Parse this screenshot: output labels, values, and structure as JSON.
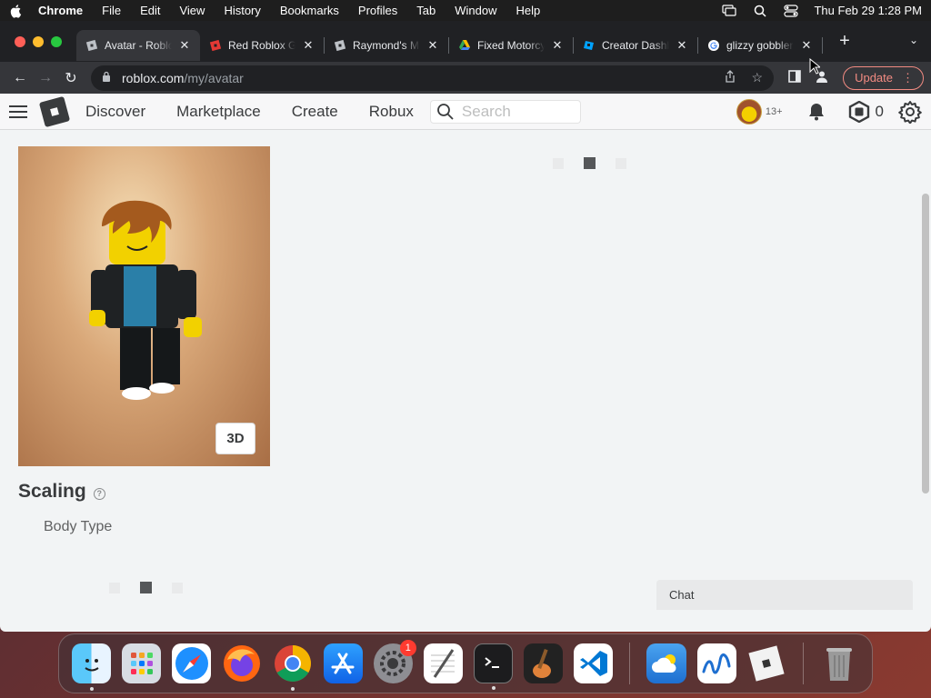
{
  "menubar": {
    "app_name": "Chrome",
    "items": [
      "File",
      "Edit",
      "View",
      "History",
      "Bookmarks",
      "Profiles",
      "Tab",
      "Window",
      "Help"
    ],
    "clock": "Thu Feb 29  1:28 PM"
  },
  "tabs": [
    {
      "title": "Avatar - Roblox",
      "favicon": "roblox-icon",
      "active": true
    },
    {
      "title": "Red Roblox Gift",
      "favicon": "roblox-red-icon",
      "active": false
    },
    {
      "title": "Raymond's Mail",
      "favicon": "roblox-icon",
      "active": false
    },
    {
      "title": "Fixed Motorcycle",
      "favicon": "google-drive-icon",
      "active": false
    },
    {
      "title": "Creator Dashboard",
      "favicon": "roblox-studio-icon",
      "active": false
    },
    {
      "title": "glizzy gobbler",
      "favicon": "google-icon",
      "active": false
    }
  ],
  "toolbar": {
    "url_host": "roblox.com",
    "url_path": "/my/avatar",
    "update_label": "Update"
  },
  "roblox_header": {
    "nav": [
      "Discover",
      "Marketplace",
      "Create",
      "Robux"
    ],
    "search_placeholder": "Search",
    "age_label": "13+",
    "robux_balance": "0"
  },
  "avatar_panel": {
    "view_toggle_label": "3D"
  },
  "scaling": {
    "title": "Scaling",
    "help_glyph": "?",
    "body_type_label": "Body Type"
  },
  "chat": {
    "label": "Chat"
  },
  "dock": {
    "apps": [
      "finder-icon",
      "launchpad-icon",
      "safari-icon",
      "firefox-icon",
      "chrome-icon",
      "app-store-icon",
      "system-settings-icon",
      "textedit-icon",
      "terminal-icon",
      "garageband-icon",
      "vscode-icon",
      "weather-icon",
      "freeform-icon",
      "roblox-icon",
      "trash-icon"
    ],
    "settings_badge": "1"
  },
  "colors": {
    "tabstrip": "#202124",
    "toolbar": "#35363a",
    "roblox_bg": "#f2f4f5",
    "update_accent": "#f28b82"
  }
}
